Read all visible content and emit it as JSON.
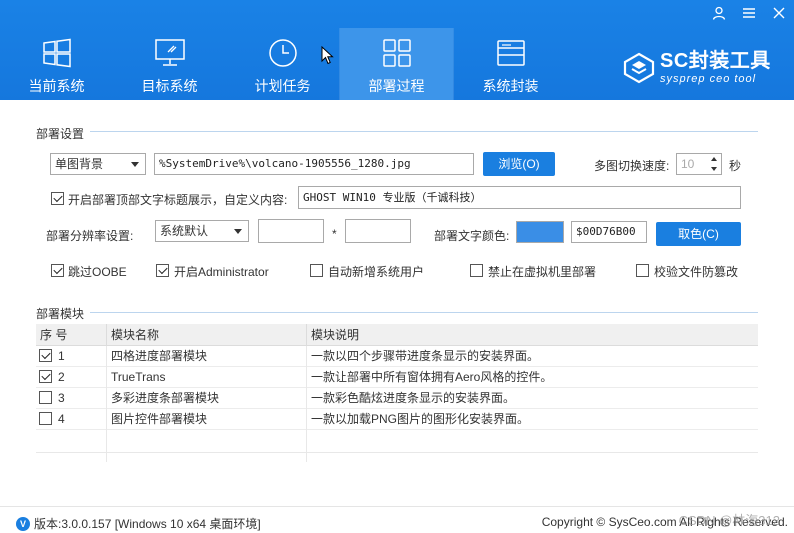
{
  "window_controls": {
    "user": "♙",
    "menu": "≡",
    "close": "✕"
  },
  "nav": {
    "items": [
      {
        "label": "当前系统",
        "icon": "windows-icon"
      },
      {
        "label": "目标系统",
        "icon": "monitor-icon"
      },
      {
        "label": "计划任务",
        "icon": "clock-icon"
      },
      {
        "label": "部署过程",
        "icon": "grid-icon",
        "active": true
      },
      {
        "label": "系统封装",
        "icon": "drive-icon"
      }
    ]
  },
  "brand": {
    "title": "SC封装工具",
    "subtitle": "sysprep ceo tool"
  },
  "deploy_settings": {
    "title": "部署设置",
    "background_mode": "单图背景",
    "background_path": "%SystemDrive%\\volcano-1905556_1280.jpg",
    "browse_label": "浏览(O)",
    "switch_speed_label": "多图切换速度:",
    "switch_speed_value": "10",
    "seconds_label": "秒",
    "title_display_label": "开启部署顶部文字标题展示，自定义内容:",
    "title_display_checked": true,
    "title_text_value": "GHOST WIN10 专业版（千诚科技）",
    "resolution_label": "部署分辨率设置:",
    "resolution_value": "系统默认",
    "width_value": "",
    "times_sign": "*",
    "height_value": "",
    "text_color_label": "部署文字颜色:",
    "text_color_value": "$00D76B00",
    "text_color_swatch": "#3a8ee6",
    "pick_color_label": "取色(C)",
    "options": [
      {
        "label": "跳过OOBE",
        "checked": true
      },
      {
        "label": "开启Administrator",
        "checked": true
      },
      {
        "label": "自动新增系统用户",
        "checked": false
      },
      {
        "label": "禁止在虚拟机里部署",
        "checked": false
      },
      {
        "label": "校验文件防篡改",
        "checked": false
      }
    ]
  },
  "modules": {
    "title": "部署模块",
    "columns": [
      "序 号",
      "模块名称",
      "模块说明"
    ],
    "rows": [
      {
        "no": "1",
        "checked": true,
        "name": "四格进度部署模块",
        "desc": "一款以四个步骤带进度条显示的安装界面。"
      },
      {
        "no": "2",
        "checked": true,
        "name": "TrueTrans",
        "desc": "一款让部署中所有窗体拥有Aero风格的控件。"
      },
      {
        "no": "3",
        "checked": false,
        "name": "多彩进度条部署模块",
        "desc": "一款彩色酷炫进度条显示的安装界面。"
      },
      {
        "no": "4",
        "checked": false,
        "name": "图片控件部署模块",
        "desc": "一款以加载PNG图片的图形化安装界面。"
      }
    ]
  },
  "footer": {
    "version": "版本:3.0.0.157 [Windows 10 x64 桌面环境]",
    "copyright": "Copyright © SysCeo.com All Rights Reserved.",
    "watermark": "CSDN @林海312"
  },
  "colors": {
    "header": "#1a82e6",
    "accent": "#1a7fe0",
    "nav_active": "#3d95ea"
  }
}
